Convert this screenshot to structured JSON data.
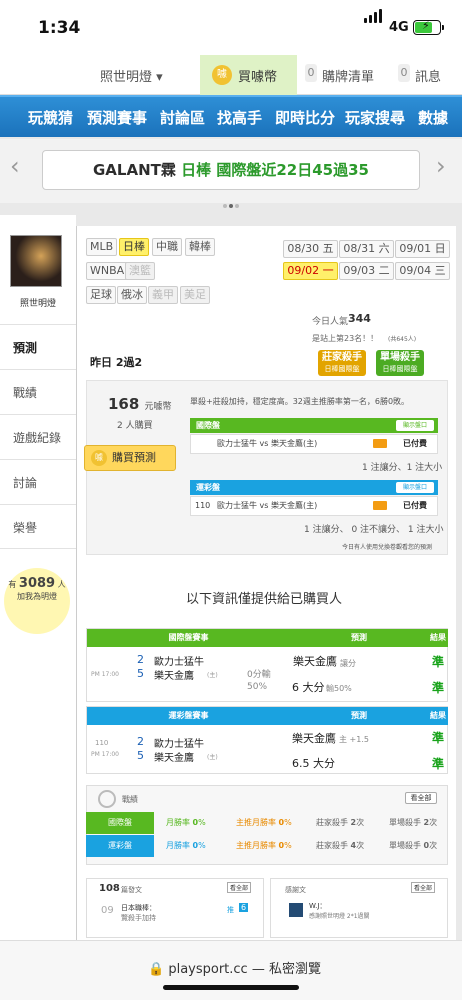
{
  "status": {
    "time": "1:34",
    "network": "4G"
  },
  "nav": {
    "user": "照世明燈 ▾",
    "buy_coins": "買噱幣",
    "cart_count": "0",
    "cart": "購牌清單",
    "msg_count": "0",
    "msgs": "訊息"
  },
  "menu": [
    "玩競猜",
    "預測賽事",
    "討論區",
    "找高手",
    "即時比分",
    "玩家搜尋",
    "數據"
  ],
  "banner": {
    "prefix": "GALANT霖",
    "mid": "日棒",
    "suffix": "國際盤近22日45過35"
  },
  "sidebar": {
    "name": "照世明燈",
    "items": [
      "預測",
      "戰績",
      "遊戲紀錄",
      "討論",
      "榮譽"
    ],
    "bulb_pre": "有",
    "bulb_count": "3089",
    "bulb_post": "人",
    "bulb_line2": "加我為明燈"
  },
  "leagues": [
    [
      "MLB",
      "日棒",
      "中職",
      "韓棒"
    ],
    [
      "WNBA",
      "澳籃"
    ],
    [
      "足球",
      "俄冰",
      "義甲",
      "美足"
    ]
  ],
  "dates": [
    [
      "08/30",
      "五"
    ],
    [
      "08/31",
      "六"
    ],
    [
      "09/01",
      "日"
    ],
    [
      "09/02",
      "一"
    ],
    [
      "09/03",
      "二"
    ],
    [
      "09/04",
      "三"
    ]
  ],
  "popularity": {
    "label": "今日人氣",
    "value": "344",
    "rank": "是站上第23名！！",
    "rank_small": "(共645人)"
  },
  "yesterday": "昨日 2過2",
  "badges": {
    "b1": "莊家殺手",
    "b1s": "日棒國際盤",
    "b2": "單場殺手",
    "b2s": "日棒國際盤"
  },
  "pred": {
    "price": "168",
    "price_unit": "元噱幣",
    "buyers": "2 人購買",
    "buy": "購買預測",
    "desc": "單殺+莊殺加持，穩定度高。32週主推勝率第一名，6勝0敗。",
    "intl_title": "國際盤",
    "intl_btn": "顯示盤口",
    "intl_match": "歐力士猛牛 vs 樂天金鷹(主)",
    "paid": "已付費",
    "intl_note": "1 注讓分、1 注大小",
    "lot_title": "運彩盤",
    "lot_btn": "顯示盤口",
    "lot_no": "110",
    "lot_match": "歐力士猛牛 vs 樂天金鷹(主)",
    "lot_note": "1 注讓分、 0 注不讓分、 1 注大小",
    "footer": "今日有人使用兌換卷觀看您的預測"
  },
  "info": "以下資訊僅提供給已購買人",
  "intl_table": {
    "h1": "國際盤賽事",
    "h2": "預測",
    "h3": "結果",
    "time": "PM 17:00",
    "r1n": "2",
    "r1": "歐力士猛牛",
    "r2n": "5",
    "r2": "樂天金鷹",
    "home": "(主)",
    "line1": "0分輸",
    "line2": "50%",
    "p1": "樂天金鷹",
    "p1b": "讓分",
    "p2": "6 大分",
    "p2b": "輸50%",
    "res1": "準",
    "res2": "準"
  },
  "lot_table": {
    "h1": "運彩盤賽事",
    "h2": "預測",
    "h3": "結果",
    "no": "110",
    "time": "PM 17:00",
    "r1n": "2",
    "r1": "歐力士猛牛",
    "r2n": "5",
    "r2": "樂天金鷹",
    "home": "(主)",
    "p1": "樂天金鷹",
    "p1b": "主 +1.5",
    "p2": "6.5 大分",
    "res1": "準",
    "res2": "準"
  },
  "stats": {
    "title": "戰績",
    "all": "看全部",
    "rows": [
      {
        "name": "國際盤",
        "c1": "月勝率",
        "v1": "0",
        "c2": "主推月勝率",
        "v2": "0",
        "c3": "莊家殺手",
        "v3": "2",
        "c4": "單場殺手",
        "v4": "2"
      },
      {
        "name": "運彩盤",
        "c1": "月勝率",
        "v1": "0",
        "c2": "主推月勝率",
        "v2": "0",
        "c3": "莊家殺手",
        "v3": "4",
        "c4": "單場殺手",
        "v4": "0"
      }
    ],
    "pct": "%",
    "times": "次"
  },
  "posts": {
    "count": "108",
    "label": "篇發文",
    "all": "看全部",
    "date": "09",
    "title": "日本職棒：",
    "sub": "覽殺手加持",
    "tag": "推",
    "tag_n": "6"
  },
  "thanks": {
    "label": "感謝文",
    "all": "看全部",
    "user": "W.J：",
    "msg": "感謝照世明燈 2*1過關"
  },
  "url": "playsport.cc — 私密瀏覽",
  "colors": {
    "blue": "#1b72bb",
    "green": "#58b821",
    "cyan": "#1aa2e0"
  }
}
